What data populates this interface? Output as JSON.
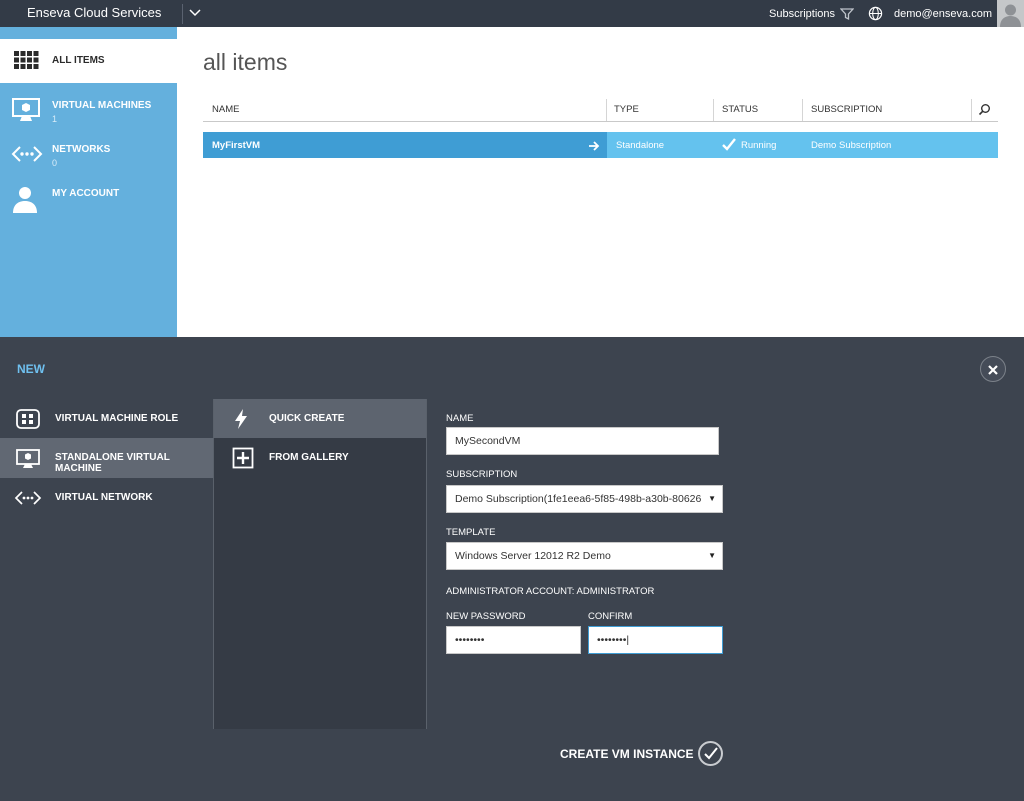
{
  "topbar": {
    "brand": "Enseva Cloud Services",
    "subscriptions_label": "Subscriptions",
    "user_email": "demo@enseva.com"
  },
  "sidebar": {
    "items": [
      {
        "label": "ALL ITEMS",
        "count": "",
        "icon": "grid-icon"
      },
      {
        "label": "VIRTUAL MACHINES",
        "count": "1",
        "icon": "monitor-icon"
      },
      {
        "label": "NETWORKS",
        "count": "0",
        "icon": "network-icon"
      },
      {
        "label": "MY ACCOUNT",
        "count": "",
        "icon": "person-icon"
      }
    ]
  },
  "main": {
    "title": "all items",
    "columns": [
      "NAME",
      "TYPE",
      "STATUS",
      "SUBSCRIPTION"
    ],
    "rows": [
      {
        "name": "MyFirstVM",
        "type": "Standalone",
        "status": "Running",
        "subscription": "Demo Subscription"
      }
    ]
  },
  "new_panel": {
    "title": "NEW",
    "categories": [
      {
        "label": "VIRTUAL MACHINE ROLE",
        "icon": "vm-role-icon"
      },
      {
        "label": "STANDALONE VIRTUAL MACHINE",
        "icon": "monitor-icon"
      },
      {
        "label": "VIRTUAL NETWORK",
        "icon": "network-icon"
      }
    ],
    "methods": [
      {
        "label": "QUICK CREATE",
        "icon": "lightning-icon"
      },
      {
        "label": "FROM GALLERY",
        "icon": "plus-box-icon"
      }
    ],
    "form": {
      "name_label": "NAME",
      "name_value": "MySecondVM",
      "subscription_label": "SUBSCRIPTION",
      "subscription_value": "Demo Subscription(1fe1eea6-5f85-498b-a30b-80626",
      "template_label": "TEMPLATE",
      "template_value": "Windows Server 12012 R2 Demo",
      "admin_label": "ADMINISTRATOR ACCOUNT: ADMINISTRATOR",
      "password_label": "NEW PASSWORD",
      "password_value": "••••••••",
      "confirm_label": "CONFIRM",
      "confirm_value": "••••••••|"
    },
    "create_label": "CREATE VM INSTANCE"
  },
  "colors": {
    "topbar": "#333b47",
    "sidebar": "#64b0dd",
    "row_selected": "#3f9dd4",
    "row": "#64c2ee",
    "panel": "#3d444f"
  }
}
